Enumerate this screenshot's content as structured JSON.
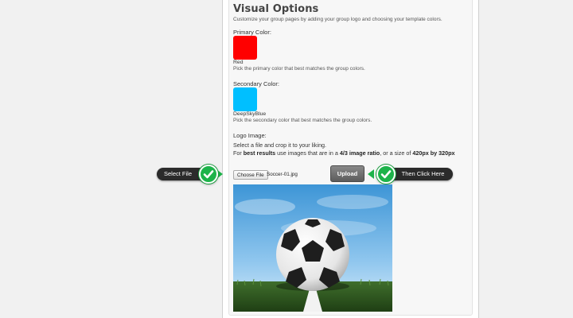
{
  "section": {
    "title": "Visual Options",
    "intro": "Customize your group pages by adding your group logo and choosing your template colors."
  },
  "primary": {
    "label": "Primary Color:",
    "color_name": "Red",
    "color": "#ff0000",
    "help": "Pick the primary color that best matches the group colors."
  },
  "secondary": {
    "label": "Secondary Color:",
    "color_name": "DeepSkyBlue",
    "color": "#00bfff",
    "help": "Pick the secondary color that best matches the group colors."
  },
  "logo": {
    "label": "Logo Image:",
    "line1": "Select a file and crop it to your liking.",
    "line2_prefix": "For ",
    "line2_bold1": "best results",
    "line2_mid": " use images that are in a ",
    "line2_bold2": "4/3 image ratio",
    "line2_mid2": ", or a size of ",
    "line2_bold3": "420px by 320px",
    "choose_label": "Choose File",
    "file_name": "Soccer-01.jpg",
    "upload_label": "Upload",
    "image_icon": "soccer-ball-on-grass-photo"
  },
  "callouts": {
    "select_file": "Select File",
    "then_click": "Then Click Here",
    "icon": "checkmark-icon",
    "accent": "#1db34a"
  }
}
